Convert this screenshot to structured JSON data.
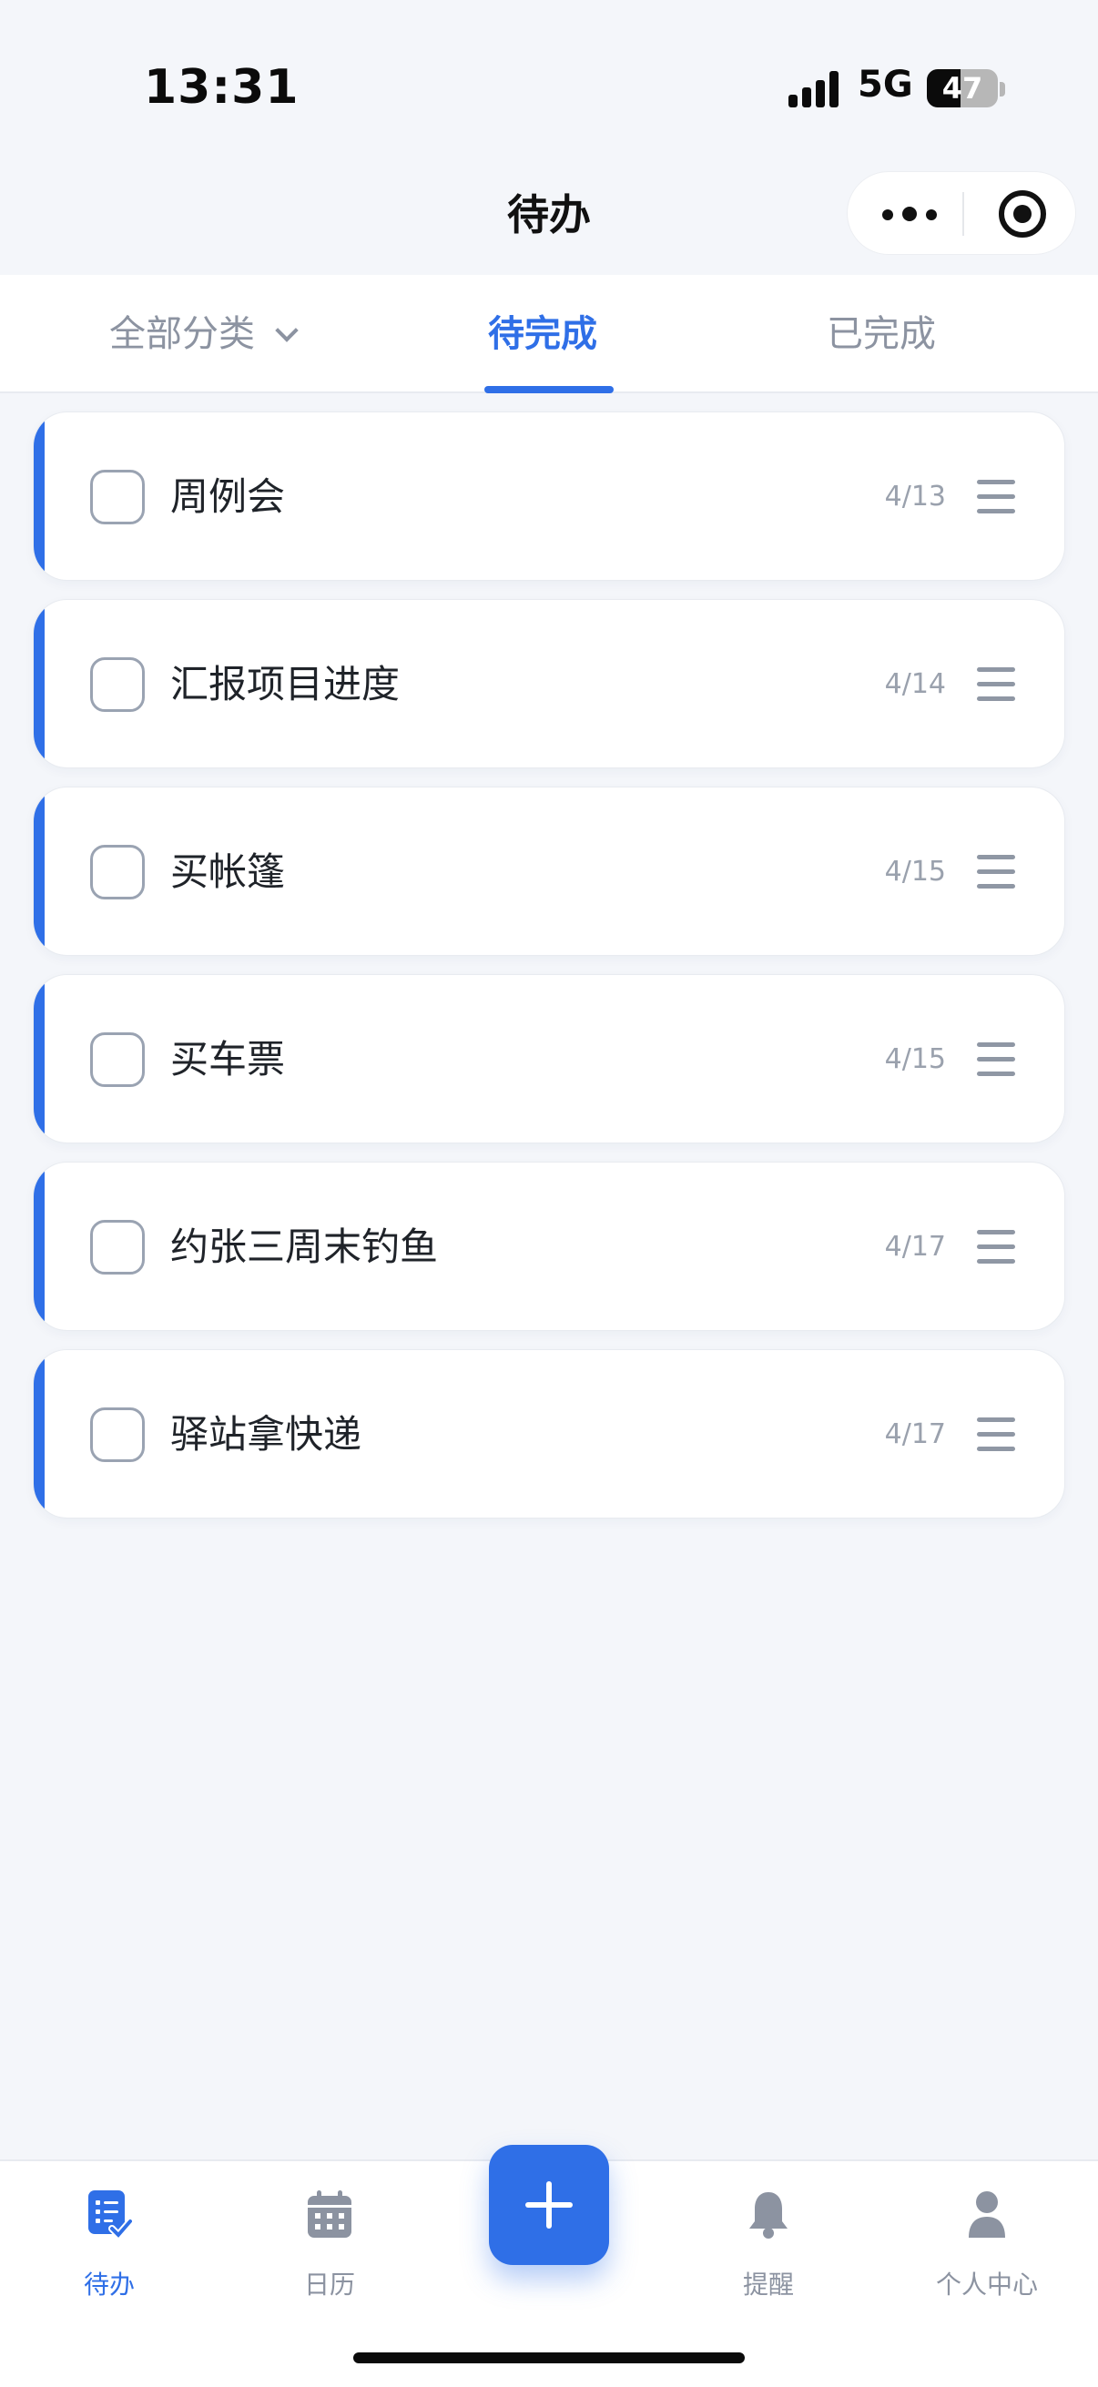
{
  "status_bar": {
    "time": "13:31",
    "network": "5G",
    "battery": "47",
    "battery_level": 0.47
  },
  "nav": {
    "title": "待办"
  },
  "tabs": {
    "all_categories": "全部分类",
    "pending": "待完成",
    "done": "已完成",
    "active": "pending"
  },
  "todos": [
    {
      "title": "周例会",
      "date": "4/13",
      "checked": false
    },
    {
      "title": "汇报项目进度",
      "date": "4/14",
      "checked": false
    },
    {
      "title": "买帐篷",
      "date": "4/15",
      "checked": false
    },
    {
      "title": "买车票",
      "date": "4/15",
      "checked": false
    },
    {
      "title": "约张三周末钓鱼",
      "date": "4/17",
      "checked": false
    },
    {
      "title": "驿站拿快递",
      "date": "4/17",
      "checked": false
    }
  ],
  "tabbar": {
    "items": [
      {
        "label": "待办",
        "icon": "todo-list-icon",
        "active": true
      },
      {
        "label": "日历",
        "icon": "calendar-icon",
        "active": false
      },
      {
        "label": "提醒",
        "icon": "bell-icon",
        "active": false
      },
      {
        "label": "个人中心",
        "icon": "user-icon",
        "active": false
      }
    ],
    "add_icon": "plus-icon"
  },
  "colors": {
    "accent": "#2f6fe7",
    "muted": "#8c93a1",
    "background": "#f4f6fa"
  }
}
